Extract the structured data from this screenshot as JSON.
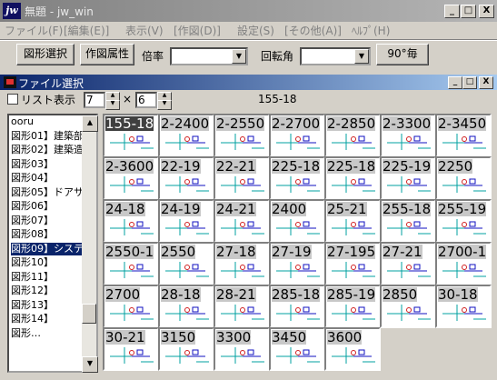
{
  "window": {
    "app_icon": "jw",
    "title": "無題 - jw_win",
    "caption_buttons": [
      "_",
      "□",
      "X"
    ]
  },
  "menu": [
    "ファイル(F)",
    "[編集(E)]",
    "表示(V)",
    "[作図(D)]",
    "設定(S)",
    "[その他(A)]",
    "ﾍﾙﾌﾟ(H)"
  ],
  "toolbar": {
    "select_shape_label": "図形選択",
    "shape_attr_label": "作図属性",
    "scale_label": "倍率",
    "scale_value": "",
    "rotation_label": "回転角",
    "rotation_value": "",
    "rotate90_label": "90°毎"
  },
  "dialog": {
    "title": "ファイル選択",
    "caption_buttons": [
      "_",
      "□",
      "X"
    ],
    "list_view_label": "リスト表示",
    "list_view_checked": false,
    "columns_value": "7",
    "times_symbol": "×",
    "rows_value": "6",
    "current_folder": "155-18"
  },
  "tree": {
    "items": [
      {
        "label": "ooru"
      },
      {
        "label": "図形01】建築部"
      },
      {
        "label": "図形02】建築造"
      },
      {
        "label": "図形03】"
      },
      {
        "label": "図形04】"
      },
      {
        "label": "図形05】ドアサッシ"
      },
      {
        "label": "図形06】"
      },
      {
        "label": "図形07】"
      },
      {
        "label": "図形08】"
      },
      {
        "label": "図形09】システムキ",
        "selected": true
      },
      {
        "label": "図形10】"
      },
      {
        "label": "図形11】"
      },
      {
        "label": "図形12】"
      },
      {
        "label": "図形13】"
      },
      {
        "label": "図形14】"
      },
      {
        "label": "図形…"
      }
    ]
  },
  "files": [
    {
      "label": "155-18",
      "selected": true
    },
    {
      "label": "2-2400"
    },
    {
      "label": "2-2550"
    },
    {
      "label": "2-2700"
    },
    {
      "label": "2-2850"
    },
    {
      "label": "2-3300"
    },
    {
      "label": "2-3450"
    },
    {
      "label": "2-3600"
    },
    {
      "label": "22-19"
    },
    {
      "label": "22-21"
    },
    {
      "label": "225-18"
    },
    {
      "label": "225-18"
    },
    {
      "label": "225-19"
    },
    {
      "label": "2250"
    },
    {
      "label": "24-18"
    },
    {
      "label": "24-19"
    },
    {
      "label": "24-21"
    },
    {
      "label": "2400"
    },
    {
      "label": "25-21"
    },
    {
      "label": "255-18"
    },
    {
      "label": "255-19"
    },
    {
      "label": "2550-1"
    },
    {
      "label": "2550"
    },
    {
      "label": "27-18"
    },
    {
      "label": "27-19"
    },
    {
      "label": "27-195"
    },
    {
      "label": "27-21"
    },
    {
      "label": "2700-1"
    },
    {
      "label": "2700"
    },
    {
      "label": "28-18"
    },
    {
      "label": "28-21"
    },
    {
      "label": "285-18"
    },
    {
      "label": "285-19"
    },
    {
      "label": "2850"
    },
    {
      "label": "30-18"
    },
    {
      "label": "30-21"
    },
    {
      "label": "3150"
    },
    {
      "label": "3300"
    },
    {
      "label": "3450"
    },
    {
      "label": "3600"
    }
  ]
}
